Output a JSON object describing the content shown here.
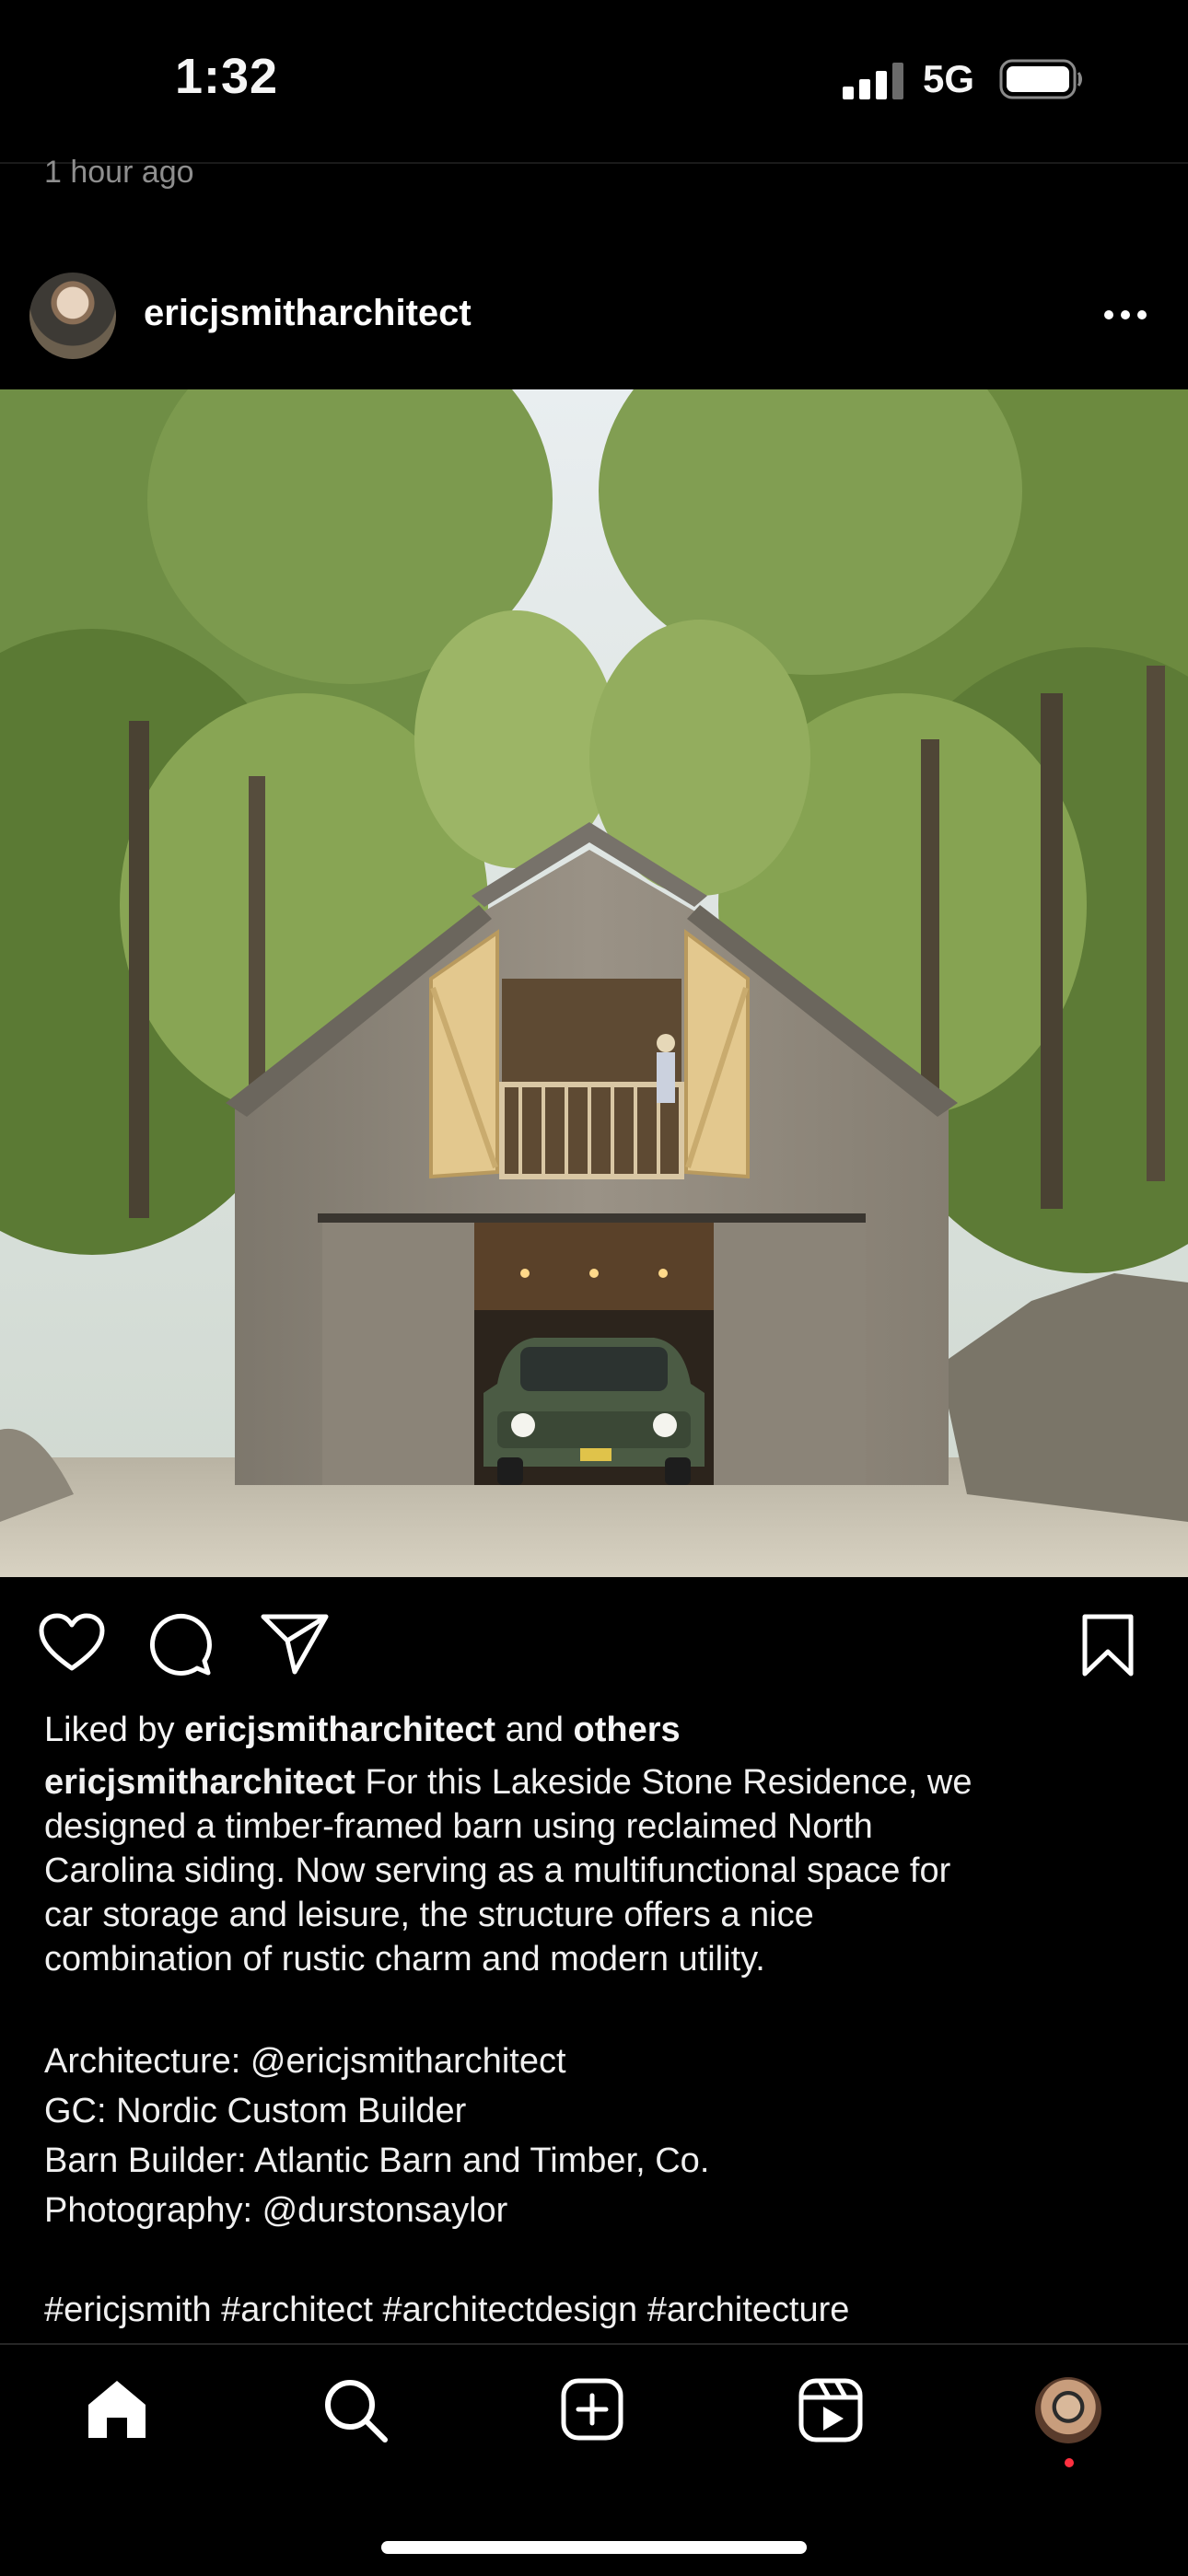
{
  "status_bar": {
    "time": "1:32",
    "network": "5G"
  },
  "previous_post": {
    "timestamp": "1 hour ago"
  },
  "post": {
    "username": "ericjsmitharchitect",
    "liked_by_prefix": "Liked by ",
    "liked_by_user": "ericjsmitharchitect",
    "liked_by_and": " and ",
    "liked_by_others": "others",
    "caption_user": "ericjsmitharchitect",
    "caption_lines": [
      " For this Lakeside Stone Residence, we",
      "designed a timber-framed barn using reclaimed North",
      "Carolina siding. Now serving as a multifunctional space for",
      "car storage and leisure, the structure offers a nice",
      "combination of rustic charm and modern utility."
    ],
    "credits": [
      "Architecture: @ericjsmitharchitect",
      "GC: Nordic Custom Builder",
      "Barn Builder: Atlantic Barn and Timber, Co.",
      "Photography: @durstonsaylor"
    ],
    "hashtags": "#ericjsmith #architect #architectdesign #architecture"
  },
  "tab_bar": {
    "items": [
      "home-icon",
      "search-icon",
      "create-icon",
      "reels-icon",
      "profile-avatar"
    ]
  },
  "colors": {
    "background": "#000000",
    "text": "#f5f5f5",
    "muted": "#8e8e8e",
    "notification": "#ff3040"
  }
}
